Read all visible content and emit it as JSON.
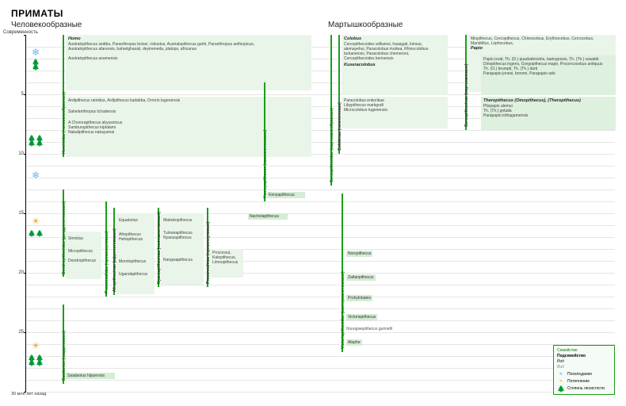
{
  "title": "ПРИМАТЫ",
  "subtitle_left": "Человекообразные",
  "subtitle_right": "Мартышкообразные",
  "y_top_label": "Современность",
  "y_bottom_label": "30 млн лет назад",
  "y_ticks": [
    "5",
    "10",
    "15",
    "20",
    "25"
  ],
  "legend": {
    "header_family": "Семейство",
    "header_subfamily": "Подсемейство",
    "header_genus": "Род",
    "header_species": "Вид",
    "cooling": "Похолодание",
    "warming": "Потепление",
    "forest": "Степень лесистости"
  },
  "left_main": {
    "homo": "Homo",
    "line1": "Australopithecus sediba, Paranthropus boisei, robustus, Australopithecus garhi, Paranthropus aethiopicus,",
    "line2": "Australopithecus afarensis, bahrelghazali, deyiremeda, platops, africanus",
    "line3": "Australopithecus anamensis",
    "ardi": "Ardipithecus ramidus, Ardipithecus kadabba, Orrorin tugenensis",
    "sahel": "Sahelanthropus tchadensis",
    "choro": "A Chororapithecus abyssinicus",
    "sambu": "Samburupithecus kiptalami",
    "nakali": "Nakalipithecus nakayamai"
  },
  "left_vbar": "Hominidae (человекообразные)",
  "right_main": {
    "colobus_h": "Colobus",
    "colobus_l1": "Cercopithecoides williamsi, haasgati, kimeui,",
    "colobus_l2": "alemayehui, Paracolobus mutiwa, Rhinocolobus",
    "colobus_l3": "turkanensis, Paracolobus chemeroni,",
    "colobus_l4": "Cercopithecoides kerioensis",
    "kusera": "Kuseracolobus",
    "para1": "Paracolobus enkorikae",
    "liby": "Libypithecus markgrafi",
    "micro": "Microcolobus tugenensis",
    "right_v1": "Cercopithecidae (мартышкообразные)",
    "right_v2": "Colobinae (толстотелые)",
    "right_v3": "Cercopithecinae (мартышковые)",
    "top_line": "Miopithecus, Cercopithecus, Chlorocebus, Erythrocebus, Cercocebus, Mandrillus, Lophocebus,",
    "papio": "Papio",
    "papio_list": "Papio izodi, Th. (D.) quadratirostris, baringensis, Th. (Th.) oswaldi",
    "dino": "Dinopithecus ingens, Gorgopithecus major, Procercocebus antiquus",
    "thero_list": "Th. (O.) brumpti, Th. (Th.) darti",
    "para_p": "Parapapio jonesi, broomi, Parapapio ado",
    "thero_h": "Theropithecus (Omopithecus), (Theropithecus)",
    "plio": "Pliopapio alemui",
    "gelada": "Th. (Th.) gelada",
    "para_loth": "Parapapio lothagamensis"
  },
  "mid_left": {
    "dendro_v": "Dendropithecidae (дендропитековые)",
    "saadani_v": "Saadanius (сааданиевые)",
    "proconsul_v": "Proconsulidae (проконсуловые)",
    "afropith_v": "Afropithecinae (афропитековые)",
    "nyanza_v": "Nyanzapithecinae (ньянзапитековые)",
    "proconsulinae_v": "Proconsulinae (проконсуловые)",
    "simiolus": "Simiolus",
    "micropith": "Micropithecus",
    "dendropith": "Dendropithecus",
    "equatorius": "Equatorius",
    "afropith": "Afropithecus",
    "heliopith": "Heliopithecus",
    "moroto": "Morotopithecus",
    "uganda": "Ugandapithecus",
    "mabok": "Mabokopithecus",
    "turkana": "Turkanapithecus",
    "nyanza": "Nyanzapithecus",
    "rangwa": "Rangwapithecus",
    "proconsul": "Proconsul,",
    "kalepith": "Kalepithecus,",
    "limno": "Limnopithecus",
    "nacho": "Nacholapithecus",
    "kamoya_v": "Kamoyapithecus (камояпитековые)",
    "kenya": "Kenyapithecus",
    "saadanius": "Saadanius hijazensis"
  },
  "mid_right": {
    "victoria_v": "Victoriapithecidae (викториапитековые)",
    "noropith": "Noropithecus",
    "zaltan": "Zaltanpithecus",
    "prohylo": "Prohylobates",
    "victoria": "Victoriapithecus",
    "nsungwe": "Nsungwepithecus gunnelli",
    "alophe": "Alophe"
  }
}
